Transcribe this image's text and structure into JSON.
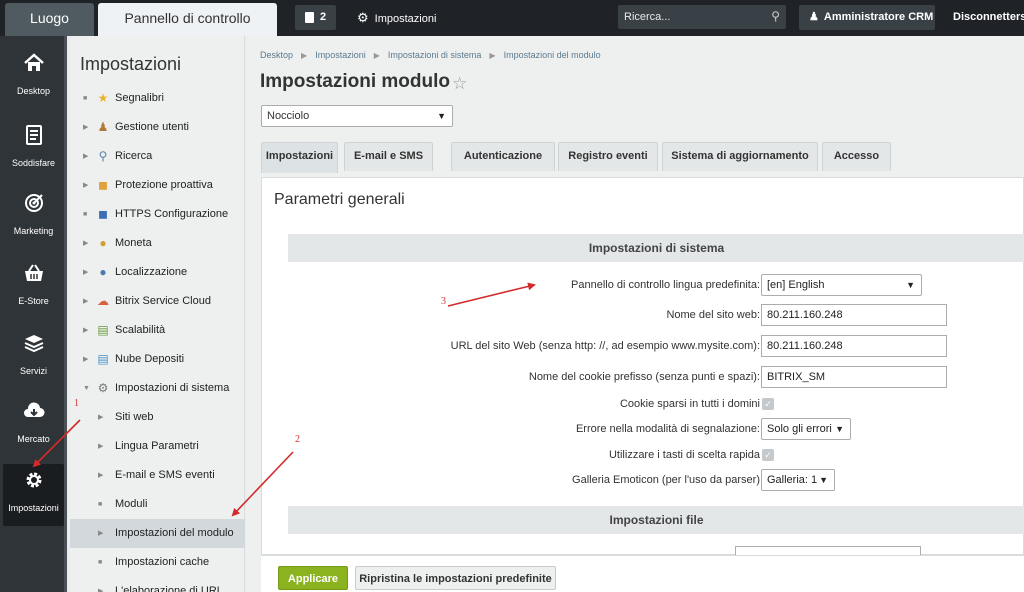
{
  "topbar": {
    "tab_luogo": "Luogo",
    "tab_pannello": "Pannello di controllo",
    "notifications_count": "2",
    "settings_label": "Impostazioni",
    "search_placeholder": "Ricerca...",
    "user_label": "Amministratore CRM",
    "logout_label": "Disconnettersi"
  },
  "leftnav": {
    "items": [
      {
        "label": "Desktop",
        "icon": "home-icon"
      },
      {
        "label": "Soddisfare",
        "icon": "document-icon"
      },
      {
        "label": "Marketing",
        "icon": "target-icon"
      },
      {
        "label": "E-Store",
        "icon": "basket-icon"
      },
      {
        "label": "Servizi",
        "icon": "layers-icon"
      },
      {
        "label": "Mercato",
        "icon": "cloud-download-icon"
      },
      {
        "label": "Impostazioni",
        "icon": "gear-icon"
      }
    ]
  },
  "sidebar": {
    "title": "Impostazioni",
    "items": [
      {
        "label": "Segnalibri",
        "icon": "star-icon"
      },
      {
        "label": "Gestione utenti",
        "icon": "user-icon"
      },
      {
        "label": "Ricerca",
        "icon": "search-icon"
      },
      {
        "label": "Protezione proattiva",
        "icon": "shield-icon"
      },
      {
        "label": "HTTPS Configurazione",
        "icon": "lock-icon"
      },
      {
        "label": "Moneta",
        "icon": "coin-icon"
      },
      {
        "label": "Localizzazione",
        "icon": "globe-icon"
      },
      {
        "label": "Bitrix Service Cloud",
        "icon": "cloud-icon"
      },
      {
        "label": "Scalabilità",
        "icon": "server-icon"
      },
      {
        "label": "Nube Depositi",
        "icon": "storage-icon"
      },
      {
        "label": "Impostazioni di sistema",
        "icon": "gear-icon"
      },
      {
        "label": "Siti web"
      },
      {
        "label": "Lingua Parametri"
      },
      {
        "label": "E-mail e SMS eventi"
      },
      {
        "label": "Moduli"
      },
      {
        "label": "Impostazioni del modulo"
      },
      {
        "label": "Impostazioni cache"
      },
      {
        "label": "L'elaborazione di URL"
      }
    ]
  },
  "breadcrumb": [
    "Desktop",
    "Impostazioni",
    "Impostazioni di sistema",
    "Impostazioni del modulo"
  ],
  "page_title": "Impostazioni modulo",
  "site_select_value": "Nocciolo",
  "tabs": [
    "Impostazioni",
    "E-mail e SMS",
    "Autenticazione",
    "Registro eventi",
    "Sistema di aggiornamento",
    "Accesso"
  ],
  "panel": {
    "title": "Parametri generali",
    "section_system": "Impostazioni di sistema",
    "section_file": "Impostazioni file",
    "fields": {
      "language_label": "Pannello di controllo lingua predefinita:",
      "language_value": "[en] English",
      "site_name_label": "Nome del sito web:",
      "site_name_value": "80.211.160.248",
      "site_url_label": "URL del sito Web (senza http: //, ad esempio www.mysite.com):",
      "site_url_value": "80.211.160.248",
      "cookie_prefix_label": "Nome del cookie prefisso (senza punti e spazi):",
      "cookie_prefix_value": "BITRIX_SM",
      "cookie_domains_label": "Cookie sparsi in tutti i domini",
      "error_mode_label": "Errore nella modalità di segnalazione:",
      "error_mode_value": "Solo gli errori",
      "hotkeys_label": "Utilizzare i tasti di scelta rapida",
      "emoticon_label": "Galleria Emoticon (per l'uso da parser)",
      "emoticon_value": "Galleria: 1"
    }
  },
  "buttons": {
    "apply": "Applicare",
    "reset": "Ripristina le impostazioni predefinite"
  },
  "annotations": {
    "label_1": "1",
    "label_2": "2",
    "label_3": "3",
    "color": "#d42a2a"
  }
}
